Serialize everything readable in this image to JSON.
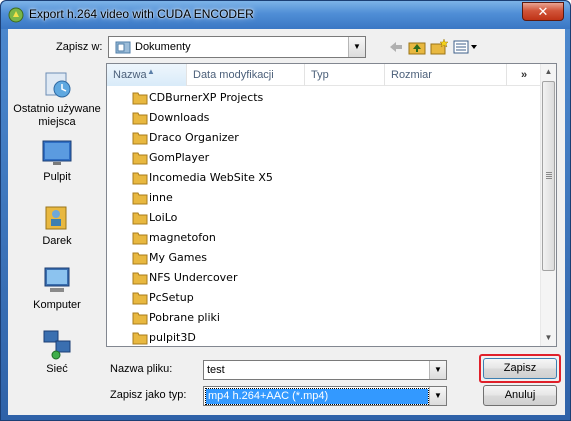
{
  "window": {
    "title": "Export h.264 video with CUDA ENCODER",
    "close_label": "✕"
  },
  "top": {
    "savein_label": "Zapisz w:",
    "savein_value": "Dokumenty"
  },
  "places": [
    {
      "label": "Ostatnio używane miejsca",
      "icon": "recent-places-icon"
    },
    {
      "label": "Pulpit",
      "icon": "desktop-icon"
    },
    {
      "label": "Darek",
      "icon": "user-folder-icon"
    },
    {
      "label": "Komputer",
      "icon": "computer-icon"
    },
    {
      "label": "Sieć",
      "icon": "network-icon"
    }
  ],
  "columns": [
    "Nazwa",
    "Data modyfikacji",
    "Typ",
    "Rozmiar"
  ],
  "more_columns": "»",
  "files": [
    "CDBurnerXP Projects",
    "Downloads",
    "Draco Organizer",
    "GomPlayer",
    "Incomedia WebSite X5",
    "inne",
    "LoiLo",
    "magnetofon",
    "My Games",
    "NFS Undercover",
    "PcSetup",
    "Pobrane pliki",
    "pulpit3D"
  ],
  "bottom": {
    "filename_label": "Nazwa pliku:",
    "filename_value": "test",
    "filetype_label": "Zapisz jako typ:",
    "filetype_value": "mp4 h.264+AAC (*.mp4)",
    "save_label": "Zapisz",
    "cancel_label": "Anuluj"
  },
  "colors": {
    "highlight": "#e0202a",
    "selection": "#3399ff",
    "folder": "#e8b840"
  }
}
